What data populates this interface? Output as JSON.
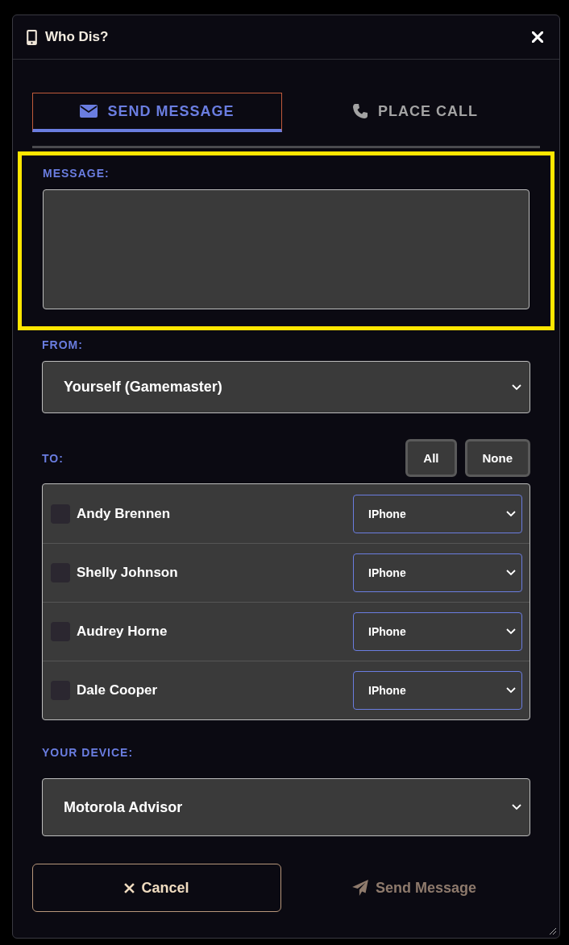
{
  "window": {
    "title": "Who Dis?"
  },
  "tabs": [
    {
      "label": "SEND MESSAGE",
      "selected": true
    },
    {
      "label": "PLACE CALL",
      "selected": false
    }
  ],
  "message": {
    "label": "MESSAGE:",
    "highlighted": true
  },
  "from": {
    "label": "FROM:",
    "value": "Yourself (Gamemaster)"
  },
  "to": {
    "label": "TO:",
    "buttons": [
      "All",
      "None"
    ],
    "recipients": [
      {
        "name": "Andy Brennen",
        "checked": false,
        "device": "IPhone"
      },
      {
        "name": "Shelly Johnson",
        "checked": false,
        "device": "IPhone"
      },
      {
        "name": "Audrey Horne",
        "checked": false,
        "device": "IPhone"
      },
      {
        "name": "Dale Cooper",
        "checked": false,
        "device": "IPhone"
      }
    ]
  },
  "device": {
    "label": "YOUR DEVICE:",
    "value": "Motorola Advisor"
  },
  "actions": {
    "cancel": {
      "label": "Cancel"
    },
    "send": {
      "label": "Send Message",
      "disabled": true
    }
  }
}
